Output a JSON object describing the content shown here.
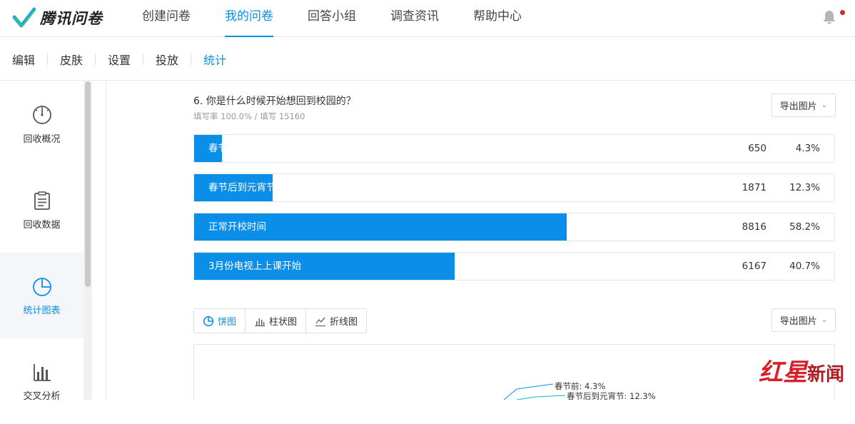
{
  "brand": {
    "name": "腾讯问卷"
  },
  "nav": {
    "items": [
      "创建问卷",
      "我的问卷",
      "回答小组",
      "调查资讯",
      "帮助中心"
    ],
    "active": 1
  },
  "subnav": {
    "items": [
      "编辑",
      "皮肤",
      "设置",
      "投放",
      "统计"
    ],
    "active": 4
  },
  "sidebar": {
    "items": [
      {
        "label": "回收概况",
        "icon": "gauge-icon"
      },
      {
        "label": "回收数据",
        "icon": "clipboard-icon"
      },
      {
        "label": "统计图表",
        "icon": "pie-chart-icon",
        "active": true
      },
      {
        "label": "交叉分析",
        "icon": "bar-chart-icon"
      }
    ]
  },
  "question": {
    "title": "6. 你是什么时候开始想回到校园的？",
    "meta": "填写率 100.0% / 填写 15160",
    "export_label": "导出图片",
    "options": [
      {
        "label": "春节前",
        "count": "650",
        "pct": "4.3%",
        "value": 4.3
      },
      {
        "label": "春节后到元宵节",
        "count": "1871",
        "pct": "12.3%",
        "value": 12.3
      },
      {
        "label": "正常开校时间",
        "count": "8816",
        "pct": "58.2%",
        "value": 58.2
      },
      {
        "label": "3月份电视上上课开始",
        "count": "6167",
        "pct": "40.7%",
        "value": 40.7
      }
    ]
  },
  "chart_tabs": {
    "items": [
      {
        "label": "饼图",
        "icon": "pie-icon"
      },
      {
        "label": "柱状图",
        "icon": "bar-icon"
      },
      {
        "label": "折线图",
        "icon": "line-icon"
      }
    ],
    "active": 0
  },
  "chart_export_label": "导出图片",
  "pie_labels": [
    "春节前: 4.3%",
    "春节后到元宵节: 12.3%"
  ],
  "watermark": {
    "part1": "红星",
    "part2": "新闻"
  },
  "colors": {
    "accent": "#0a8ee8",
    "notify": "#e8202a"
  }
}
